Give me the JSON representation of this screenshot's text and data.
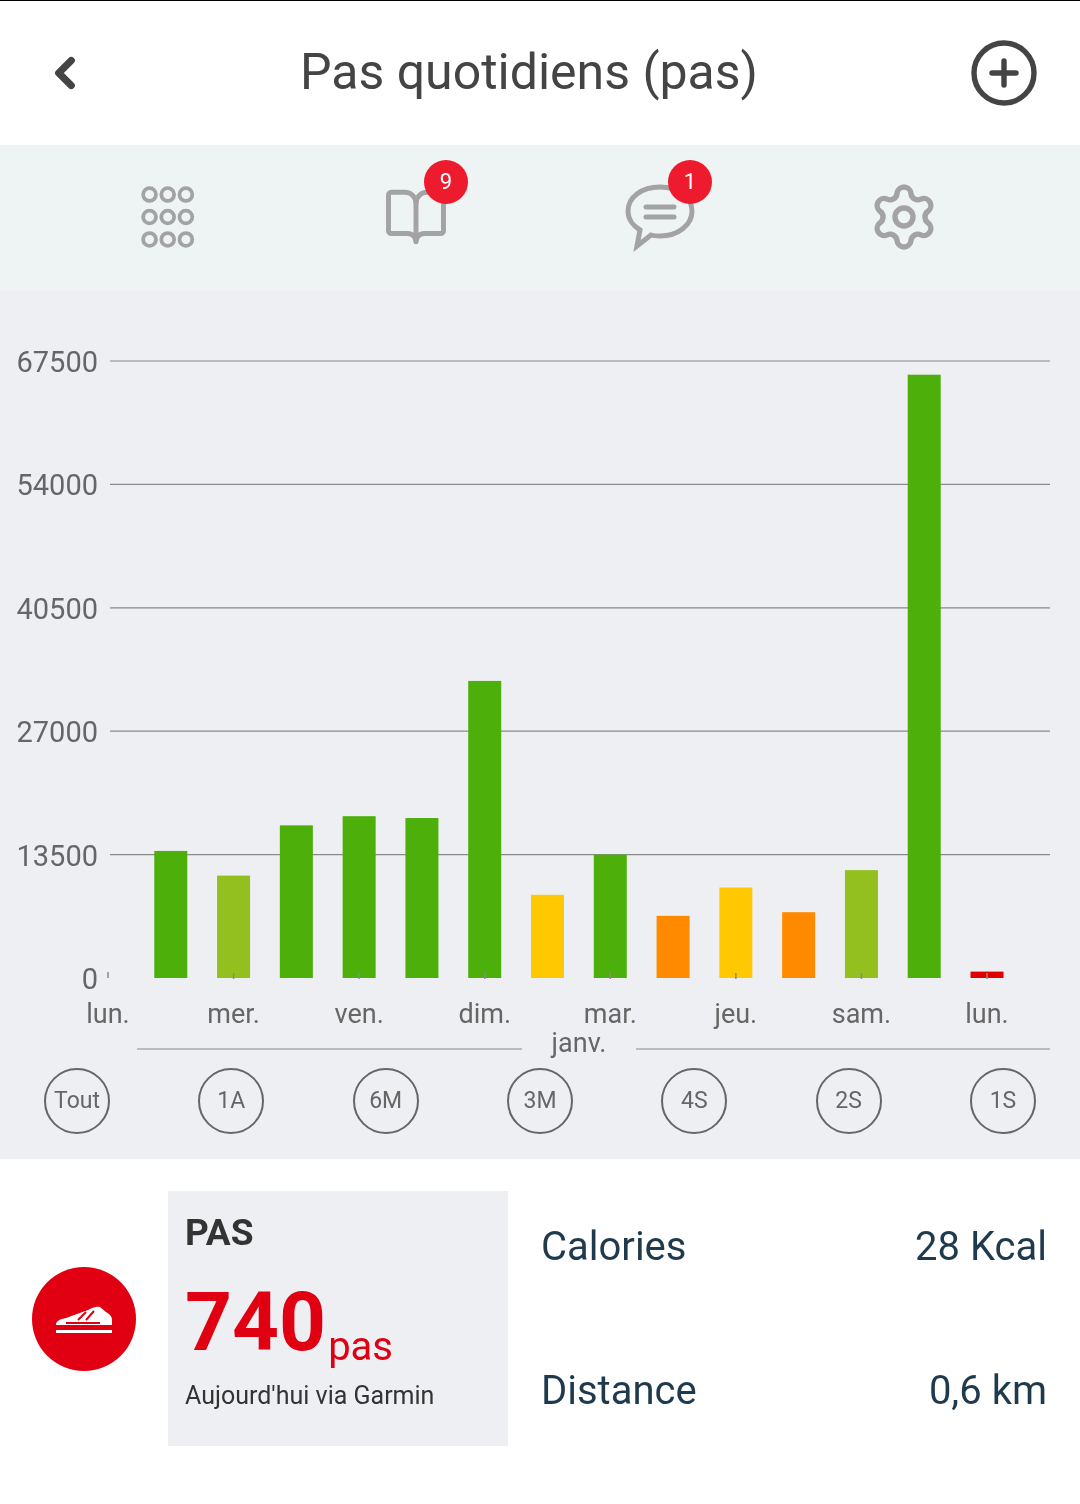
{
  "header": {
    "title": "Pas quotidiens (pas)"
  },
  "toolbar": [
    {
      "kind": "grid"
    },
    {
      "kind": "book",
      "badge": "9"
    },
    {
      "kind": "chat",
      "badge": "1"
    },
    {
      "kind": "settings"
    }
  ],
  "chart": {
    "chart_data": {
      "type": "bar",
      "ylim": [
        0,
        67500
      ],
      "yticks": [
        0,
        13500,
        27000,
        40500,
        54000,
        67500
      ],
      "grid": true,
      "categories": [
        "lun.",
        null,
        "mer.",
        null,
        "ven.",
        null,
        "dim.",
        null,
        "mar.",
        null,
        "jeu.",
        null,
        "sam.",
        null,
        "lun."
      ],
      "series": [
        {
          "color": "#4caf0a",
          "values": [
            null,
            13900,
            null,
            16700,
            17700,
            17500,
            32500,
            null,
            13500,
            null,
            null,
            null,
            null,
            66000,
            null
          ]
        },
        {
          "color": "#93c01f",
          "values": [
            null,
            null,
            11200,
            null,
            null,
            null,
            null,
            null,
            null,
            null,
            null,
            null,
            11800,
            null,
            null
          ]
        },
        {
          "color": "#ffc800",
          "values": [
            null,
            null,
            null,
            null,
            null,
            null,
            null,
            9100,
            null,
            null,
            9900,
            null,
            null,
            null,
            null
          ]
        },
        {
          "color": "#ff8a00",
          "values": [
            null,
            null,
            null,
            null,
            null,
            null,
            null,
            null,
            null,
            6800,
            null,
            7200,
            null,
            null,
            null
          ]
        },
        {
          "color": "#e00000",
          "values": [
            null,
            null,
            null,
            null,
            null,
            null,
            null,
            null,
            null,
            null,
            null,
            null,
            null,
            null,
            700
          ]
        }
      ],
      "annotations": [
        {
          "text": "janv."
        }
      ]
    }
  },
  "periods": [
    {
      "label": "Tout",
      "selected": false
    },
    {
      "label": "1A",
      "selected": false
    },
    {
      "label": "6M",
      "selected": false
    },
    {
      "label": "3M",
      "selected": false
    },
    {
      "label": "4S",
      "selected": false
    },
    {
      "label": "2S",
      "selected": false
    },
    {
      "label": "1S",
      "selected": false
    }
  ],
  "summary": {
    "title": "PAS",
    "value": "740",
    "unit": "pas",
    "source": "Aujourd'hui via Garmin"
  },
  "stats": [
    {
      "label": "Calories",
      "value": "28 Kcal"
    },
    {
      "label": "Distance",
      "value": "0,6 km"
    }
  ]
}
